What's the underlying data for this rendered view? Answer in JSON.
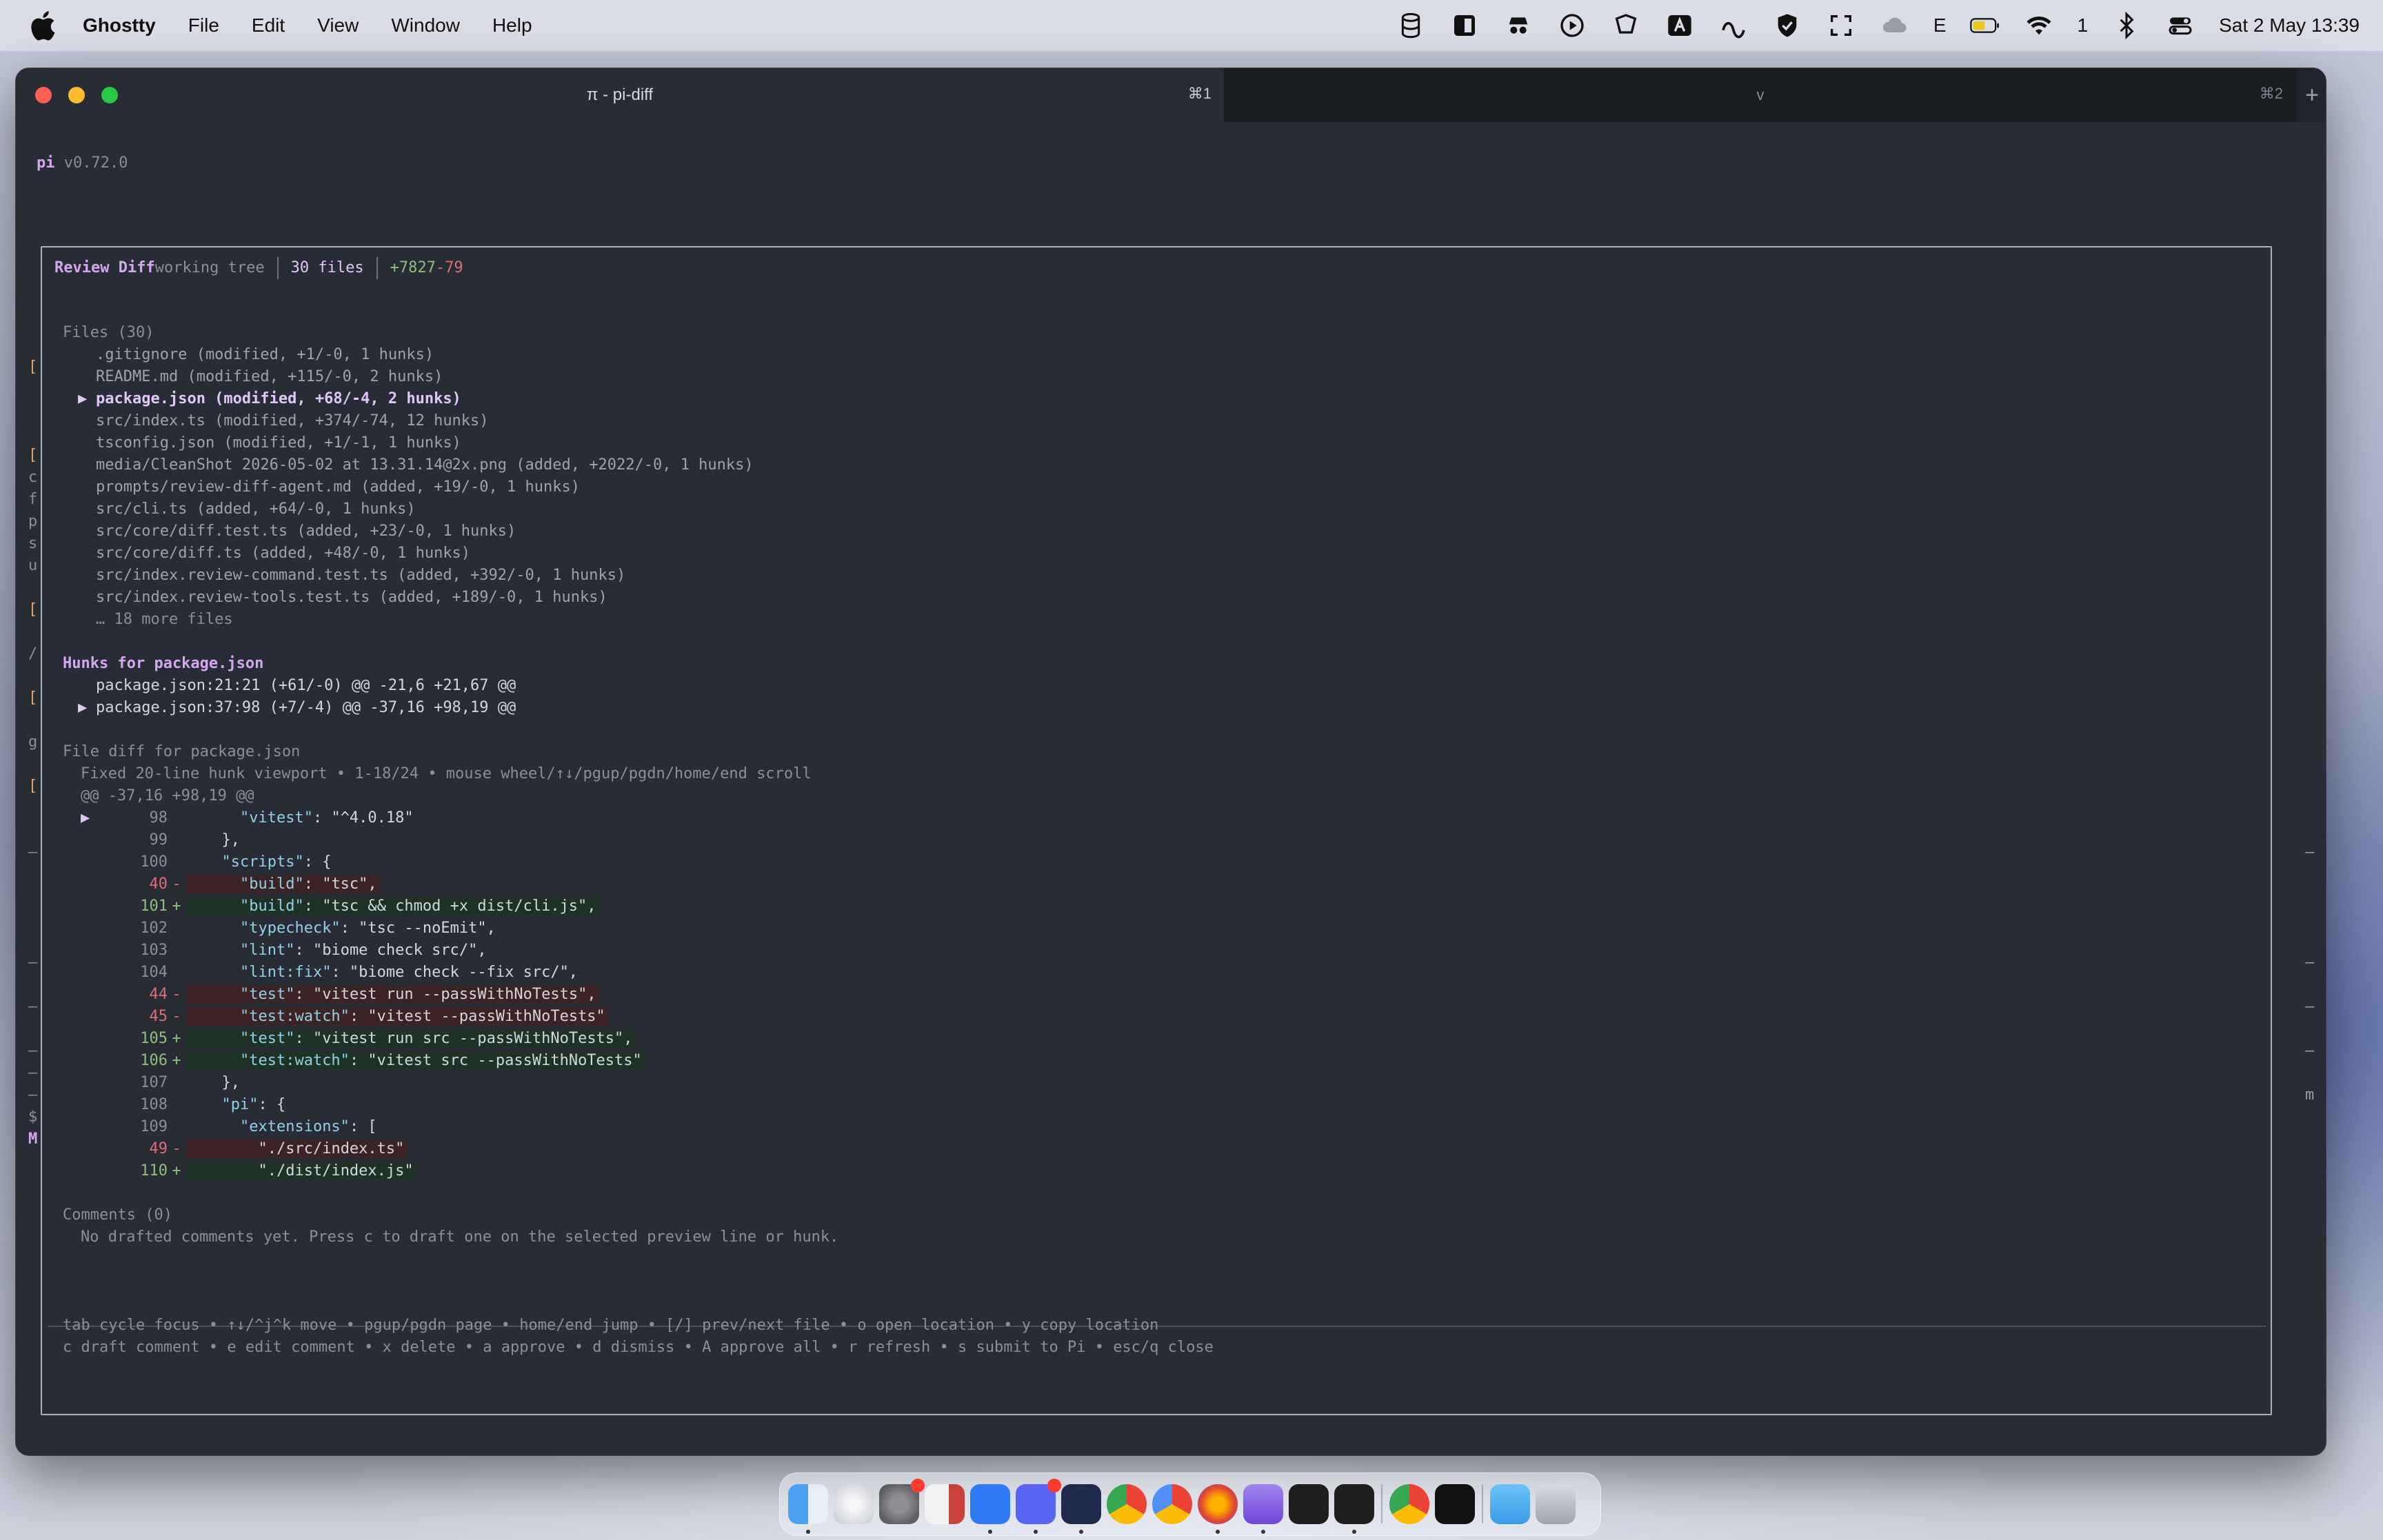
{
  "menubar": {
    "app_name": "Ghostty",
    "menus": [
      "File",
      "Edit",
      "View",
      "Window",
      "Help"
    ],
    "status_number": "1",
    "status_letter": "E",
    "clock": "Sat 2 May  13:39"
  },
  "window": {
    "tab1_title": "π - pi-diff",
    "tab1_shortcut": "⌘1",
    "tab2_title": "v",
    "tab2_shortcut": "⌘2",
    "new_tab": "+"
  },
  "terminal": {
    "app": "pi",
    "version": "v0.72.0",
    "header": {
      "title": "Review Diff",
      "mode": "working tree",
      "files": "30 files",
      "added": "+7827",
      "removed": "-79"
    },
    "files_heading": "Files (30)",
    "files": [
      {
        "marker": " ",
        "text": ".gitignore (modified, +1/-0, 1 hunks)"
      },
      {
        "marker": " ",
        "text": "README.md (modified, +115/-0, 2 hunks)"
      },
      {
        "marker": "▶",
        "text": "package.json (modified, +68/-4, 2 hunks)"
      },
      {
        "marker": " ",
        "text": "src/index.ts (modified, +374/-74, 12 hunks)"
      },
      {
        "marker": " ",
        "text": "tsconfig.json (modified, +1/-1, 1 hunks)"
      },
      {
        "marker": " ",
        "text": "media/CleanShot 2026-05-02 at 13.31.14@2x.png (added, +2022/-0, 1 hunks)"
      },
      {
        "marker": " ",
        "text": "prompts/review-diff-agent.md (added, +19/-0, 1 hunks)"
      },
      {
        "marker": " ",
        "text": "src/cli.ts (added, +64/-0, 1 hunks)"
      },
      {
        "marker": " ",
        "text": "src/core/diff.test.ts (added, +23/-0, 1 hunks)"
      },
      {
        "marker": " ",
        "text": "src/core/diff.ts (added, +48/-0, 1 hunks)"
      },
      {
        "marker": " ",
        "text": "src/index.review-command.test.ts (added, +392/-0, 1 hunks)"
      },
      {
        "marker": " ",
        "text": "src/index.review-tools.test.ts (added, +189/-0, 1 hunks)"
      }
    ],
    "more_files": "… 18 more files",
    "hunks_heading": "Hunks for package.json",
    "hunks": [
      {
        "marker": " ",
        "text": "package.json:21:21 (+61/-0) @@ -21,6 +21,67 @@"
      },
      {
        "marker": "▶",
        "text": "package.json:37:98 (+7/-4) @@ -37,16 +98,19 @@"
      }
    ],
    "diff_heading": "File diff for package.json",
    "diff_viewport": "Fixed 20-line hunk viewport • 1-18/24 • mouse wheel/↑↓/pgup/pgdn/home/end scroll",
    "diff_hunk_header": "@@ -37,16 +98,19 @@",
    "diff_lines": [
      {
        "marker": "▶",
        "num": "98",
        "sign": " ",
        "kind": "ctx",
        "indent": "    ",
        "key": "\"vitest\"",
        "rest": ": \"^4.0.18\""
      },
      {
        "marker": " ",
        "num": "99",
        "sign": " ",
        "kind": "ctx",
        "indent": "  ",
        "key": "",
        "rest": "},"
      },
      {
        "marker": " ",
        "num": "100",
        "sign": " ",
        "kind": "ctx",
        "indent": "  ",
        "key": "\"scripts\"",
        "rest": ": {"
      },
      {
        "marker": " ",
        "num": "40",
        "sign": "-",
        "kind": "del",
        "indent": "    ",
        "key": "\"build\"",
        "rest": ": \"tsc\","
      },
      {
        "marker": " ",
        "num": "101",
        "sign": "+",
        "kind": "add",
        "indent": "    ",
        "key": "\"build\"",
        "rest": ": \"tsc && chmod +x dist/cli.js\","
      },
      {
        "marker": " ",
        "num": "102",
        "sign": " ",
        "kind": "ctx",
        "indent": "    ",
        "key": "\"typecheck\"",
        "rest": ": \"tsc --noEmit\","
      },
      {
        "marker": " ",
        "num": "103",
        "sign": " ",
        "kind": "ctx",
        "indent": "    ",
        "key": "\"lint\"",
        "rest": ": \"biome check src/\","
      },
      {
        "marker": " ",
        "num": "104",
        "sign": " ",
        "kind": "ctx",
        "indent": "    ",
        "key": "\"lint:fix\"",
        "rest": ": \"biome check --fix src/\","
      },
      {
        "marker": " ",
        "num": "44",
        "sign": "-",
        "kind": "del",
        "indent": "    ",
        "key": "\"test\"",
        "rest": ": \"vitest run --passWithNoTests\","
      },
      {
        "marker": " ",
        "num": "45",
        "sign": "-",
        "kind": "del",
        "indent": "    ",
        "key": "\"test:watch\"",
        "rest": ": \"vitest --passWithNoTests\""
      },
      {
        "marker": " ",
        "num": "105",
        "sign": "+",
        "kind": "add",
        "indent": "    ",
        "key": "\"test\"",
        "rest": ": \"vitest run src --passWithNoTests\","
      },
      {
        "marker": " ",
        "num": "106",
        "sign": "+",
        "kind": "add",
        "indent": "    ",
        "key": "\"test:watch\"",
        "rest": ": \"vitest src --passWithNoTests\""
      },
      {
        "marker": " ",
        "num": "107",
        "sign": " ",
        "kind": "ctx",
        "indent": "  ",
        "key": "",
        "rest": "},"
      },
      {
        "marker": " ",
        "num": "108",
        "sign": " ",
        "kind": "ctx",
        "indent": "  ",
        "key": "\"pi\"",
        "rest": ": {"
      },
      {
        "marker": " ",
        "num": "109",
        "sign": " ",
        "kind": "ctx",
        "indent": "    ",
        "key": "\"extensions\"",
        "rest": ": ["
      },
      {
        "marker": " ",
        "num": "49",
        "sign": "-",
        "kind": "del",
        "indent": "      ",
        "key": "",
        "rest": "\"./src/index.ts\""
      },
      {
        "marker": " ",
        "num": "110",
        "sign": "+",
        "kind": "add",
        "indent": "      ",
        "key": "",
        "rest": "\"./dist/index.js\""
      }
    ],
    "comments_heading": "Comments (0)",
    "comments_empty": "No drafted comments yet. Press c to draft one on the selected preview line or hunk.",
    "help_line1": "tab cycle focus • ↑↓/^j^k move • pgup/pgdn page • home/end jump • [/] prev/next file • o open location • y copy location",
    "help_line2": "c draft comment • e edit comment • x delete • a approve • d dismiss • A approve all • r refresh • s submit to Pi • esc/q close",
    "gutter_left": [
      "[",
      "[",
      "c",
      "f",
      "p",
      "s",
      "u",
      "[",
      "/",
      "[",
      "g",
      "[",
      "–",
      "–",
      "–",
      "–",
      "–",
      "–",
      "$",
      "M"
    ],
    "gutter_right": [
      "–",
      "–",
      "–",
      "–",
      "m"
    ]
  },
  "colors": {
    "terminal_bg": "#282c34",
    "accent_pink": "#d7a6f0",
    "added_green": "#8ec07c",
    "removed_red": "#e06c75",
    "key_cyan": "#8fd1e6"
  },
  "dock": {
    "apps": [
      "finder-icon",
      "launchpad-icon",
      "system-settings-icon",
      "notes-icon",
      "zalo-icon",
      "discord-icon",
      "terminal-icon",
      "chrome-icon",
      "chrome-canary-icon",
      "firefox-icon",
      "database-icon",
      "figma-icon",
      "vscode-icon",
      "chrome-profile-icon",
      "activity-monitor-icon",
      "downloads-icon",
      "trash-icon"
    ]
  }
}
